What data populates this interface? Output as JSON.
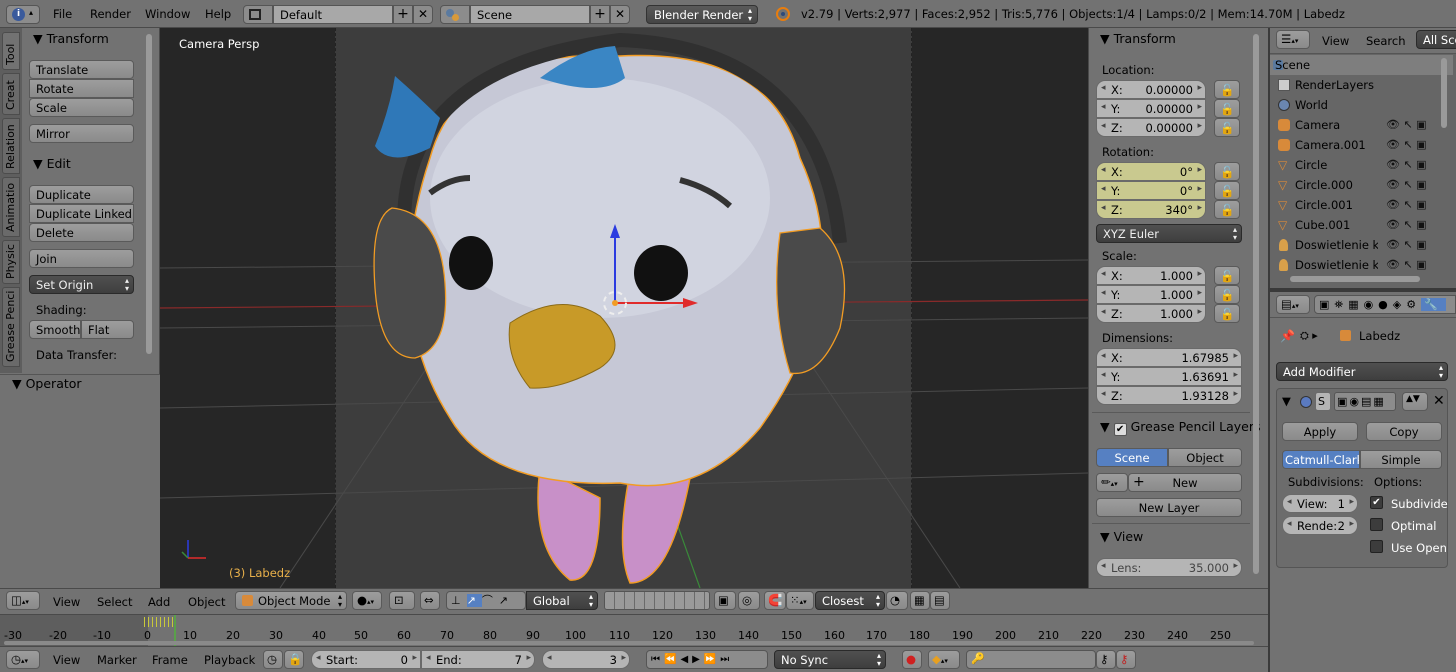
{
  "top_menu": {
    "file": "File",
    "render": "Render",
    "window": "Window",
    "help": "Help",
    "layout": "Default",
    "scene": "Scene",
    "engine": "Blender Render",
    "stats": "v2.79 | Verts:2,977 | Faces:2,952 | Tris:5,776 | Objects:1/4 | Lamps:0/2 | Mem:14.70M | Labedz"
  },
  "left_tabs": [
    "Tool",
    "Creat",
    "Relation",
    "Animatio",
    "Physic",
    "Grease Penci"
  ],
  "tool_panel": {
    "transform_header": "Transform",
    "translate": "Translate",
    "rotate": "Rotate",
    "scale": "Scale",
    "mirror": "Mirror",
    "edit_header": "Edit",
    "duplicate": "Duplicate",
    "duplicate_linked": "Duplicate Linked",
    "delete": "Delete",
    "join": "Join",
    "set_origin": "Set Origin",
    "shading_label": "Shading:",
    "smooth": "Smooth",
    "flat": "Flat",
    "data_transfer": "Data Transfer:",
    "operator_header": "Operator"
  },
  "viewport": {
    "view_label": "Camera Persp",
    "object_label": "(3) Labedz"
  },
  "properties_panel": {
    "transform_header": "Transform",
    "location_label": "Location:",
    "loc": [
      {
        "axis": "X:",
        "value": "0.00000"
      },
      {
        "axis": "Y:",
        "value": "0.00000"
      },
      {
        "axis": "Z:",
        "value": "0.00000"
      }
    ],
    "rotation_label": "Rotation:",
    "rot": [
      {
        "axis": "X:",
        "value": "0°"
      },
      {
        "axis": "Y:",
        "value": "0°"
      },
      {
        "axis": "Z:",
        "value": "340°"
      }
    ],
    "rot_mode": "XYZ Euler",
    "scale_label": "Scale:",
    "scl": [
      {
        "axis": "X:",
        "value": "1.000"
      },
      {
        "axis": "Y:",
        "value": "1.000"
      },
      {
        "axis": "Z:",
        "value": "1.000"
      }
    ],
    "dimensions_label": "Dimensions:",
    "dim": [
      {
        "axis": "X:",
        "value": "1.67985"
      },
      {
        "axis": "Y:",
        "value": "1.63691"
      },
      {
        "axis": "Z:",
        "value": "1.93128"
      }
    ],
    "gp_header": "Grease Pencil Layers",
    "gp_scene": "Scene",
    "gp_object": "Object",
    "gp_new": "New",
    "gp_new_layer": "New Layer",
    "view_header": "View",
    "lens_label": "Lens:",
    "lens_value": "35.000"
  },
  "outliner": {
    "view": "View",
    "search": "Search",
    "all_scenes": "All Sce",
    "rows": [
      "Scene",
      "RenderLayers",
      "World",
      "Camera",
      "Camera.001",
      "Circle",
      "Circle.000",
      "Circle.001",
      "Cube.001",
      "Doswietlenie kol",
      "Doswietlenie kol"
    ]
  },
  "modifier_panel": {
    "object_name": "Labedz",
    "add_modifier": "Add Modifier",
    "mod_name": "S",
    "apply": "Apply",
    "copy": "Copy",
    "catmull": "Catmull-Clark",
    "simple": "Simple",
    "subdivisions_label": "Subdivisions:",
    "options_label": "Options:",
    "view_field": "View:",
    "view_value": "1",
    "render_field": "Rende:",
    "render_value": "2",
    "subdivide": "Subdivide",
    "optimal": "Optimal",
    "use_open": "Use Open"
  },
  "view3d_header": {
    "view": "View",
    "select": "Select",
    "add": "Add",
    "object": "Object",
    "mode": "Object Mode",
    "orientation": "Global",
    "snap": "Closest"
  },
  "timeline_ticks": [
    "-30",
    "-20",
    "-10",
    "0",
    "10",
    "20",
    "30",
    "40",
    "50",
    "60",
    "70",
    "80",
    "90",
    "100",
    "110",
    "120",
    "130",
    "140",
    "150",
    "160",
    "170",
    "180",
    "190",
    "200",
    "210",
    "220",
    "230",
    "240",
    "250"
  ],
  "timeline_header": {
    "view": "View",
    "marker": "Marker",
    "frame": "Frame",
    "playback": "Playback",
    "start_label": "Start:",
    "start_value": "0",
    "end_label": "End:",
    "end_value": "7",
    "current": "3",
    "sync": "No Sync"
  },
  "colors": {
    "accent": "#5680c2",
    "selection_orange": "#f29c23",
    "rotation_highlight": "#c9c98f"
  }
}
